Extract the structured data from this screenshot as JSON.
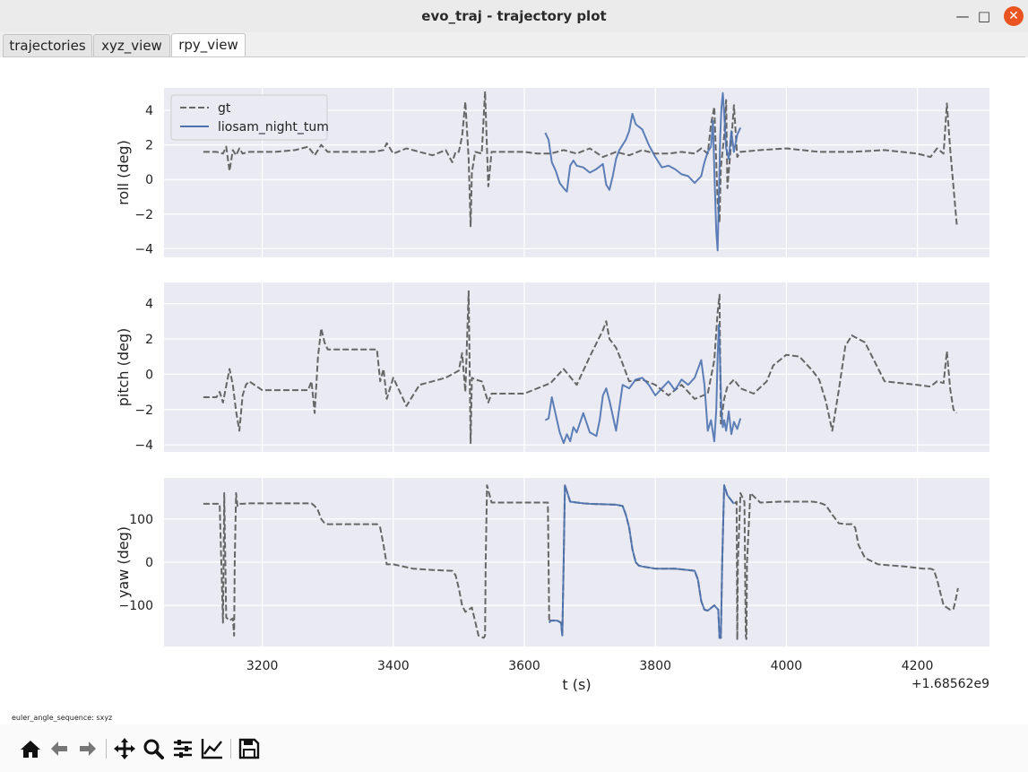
{
  "window": {
    "title": "evo_traj - trajectory plot"
  },
  "tabs": [
    {
      "label": "trajectories",
      "active": false
    },
    {
      "label": "xyz_view",
      "active": false
    },
    {
      "label": "rpy_view",
      "active": true
    }
  ],
  "status_text": "euler_angle_sequence: sxyz",
  "toolbar": {
    "icons": [
      "home-icon",
      "back-arrow-icon",
      "forward-arrow-icon",
      "pan-icon",
      "zoom-icon",
      "subplots-config-icon",
      "axes-edit-icon",
      "save-icon"
    ]
  },
  "colors": {
    "gt": "#666666",
    "estimate": "#4c72b0",
    "axes_bg": "#eaeaf2",
    "grid": "#ffffff",
    "close_btn": "#e95420"
  },
  "chart_data": {
    "type": "line",
    "xlabel": "t (s)",
    "x_offset_label": "+1.68562e9",
    "xlim": [
      3050,
      4310
    ],
    "xticks": [
      3200,
      3400,
      3600,
      3800,
      4000,
      4200
    ],
    "legend": {
      "placement": "top-left",
      "entries": [
        "gt",
        "liosam_night_tum"
      ]
    },
    "grid": true,
    "subplots": [
      {
        "ylabel": "roll (deg)",
        "ylim": [
          -4.5,
          5.3
        ],
        "yticks": [
          4,
          2,
          0,
          -2,
          -4
        ],
        "series": [
          {
            "name": "gt",
            "style": "dashed",
            "x": [
              3110,
              3130,
              3140,
              3145,
              3150,
              3155,
              3160,
              3165,
              3170,
              3180,
              3190,
              3200,
              3220,
              3250,
              3270,
              3280,
              3290,
              3300,
              3330,
              3370,
              3385,
              3390,
              3400,
              3420,
              3440,
              3460,
              3480,
              3490,
              3495,
              3500,
              3505,
              3510,
              3515,
              3518,
              3520,
              3525,
              3535,
              3540,
              3545,
              3550,
              3560,
              3600,
              3620,
              3640,
              3660,
              3680,
              3700,
              3720,
              3740,
              3760,
              3780,
              3800,
              3820,
              3840,
              3860,
              3870,
              3880,
              3885,
              3890,
              3895,
              3898,
              3900,
              3905,
              3908,
              3910,
              3915,
              3920,
              3925,
              3930,
              3960,
              4000,
              4050,
              4100,
              4150,
              4200,
              4220,
              4230,
              4240,
              4245,
              4250,
              4255,
              4260
            ],
            "y": [
              1.6,
              1.6,
              1.5,
              1.9,
              0.5,
              1.7,
              1.4,
              1.8,
              1.5,
              1.6,
              1.6,
              1.6,
              1.6,
              1.7,
              1.9,
              1.4,
              2.0,
              1.6,
              1.6,
              1.6,
              1.7,
              2.1,
              1.5,
              1.8,
              1.6,
              1.4,
              1.7,
              1.0,
              1.6,
              1.6,
              2.5,
              4.5,
              1.2,
              -2.7,
              0.4,
              1.6,
              1.5,
              5.1,
              -0.4,
              1.6,
              1.6,
              1.6,
              1.5,
              1.5,
              1.7,
              1.5,
              1.8,
              1.3,
              1.6,
              1.4,
              1.7,
              1.5,
              1.5,
              1.6,
              1.5,
              1.8,
              1.5,
              3.2,
              4.2,
              -1.3,
              -2.5,
              0.7,
              2.5,
              4.6,
              -0.5,
              1.8,
              4.3,
              1.3,
              1.6,
              1.7,
              1.8,
              1.6,
              1.6,
              1.7,
              1.5,
              1.3,
              1.8,
              1.5,
              4.4,
              1.8,
              -0.4,
              -2.6
            ]
          },
          {
            "name": "liosam_night_tum",
            "style": "solid",
            "x": [
              3632,
              3637,
              3642,
              3648,
              3654,
              3660,
              3665,
              3670,
              3675,
              3680,
              3690,
              3700,
              3710,
              3720,
              3725,
              3730,
              3735,
              3740,
              3745,
              3750,
              3755,
              3760,
              3765,
              3770,
              3780,
              3790,
              3800,
              3810,
              3820,
              3830,
              3840,
              3850,
              3860,
              3870,
              3875,
              3880,
              3885,
              3888,
              3890,
              3893,
              3895,
              3897,
              3899,
              3901,
              3903,
              3905,
              3908,
              3912,
              3916,
              3920,
              3925,
              3930
            ],
            "y": [
              2.7,
              2.3,
              1.0,
              0.5,
              -0.2,
              -0.5,
              -0.7,
              0.8,
              1.1,
              0.8,
              0.7,
              0.4,
              0.6,
              0.9,
              -0.3,
              -0.6,
              0.2,
              1.2,
              1.7,
              2.0,
              2.3,
              2.8,
              3.8,
              3.2,
              2.9,
              2.0,
              1.3,
              0.7,
              0.8,
              0.6,
              0.3,
              0.2,
              -0.2,
              0.2,
              1.0,
              1.6,
              1.9,
              3.4,
              0.5,
              -3.0,
              -4.1,
              -1.0,
              2.5,
              4.2,
              5.0,
              3.8,
              1.8,
              1.2,
              2.8,
              1.6,
              2.6,
              3.0
            ]
          }
        ]
      },
      {
        "ylabel": "pitch (deg)",
        "ylim": [
          -4.4,
          5.2
        ],
        "yticks": [
          4,
          2,
          0,
          -2,
          -4
        ],
        "series": [
          {
            "name": "gt",
            "style": "dashed",
            "x": [
              3110,
              3130,
              3135,
              3140,
              3150,
              3155,
              3160,
              3165,
              3170,
              3175,
              3180,
              3200,
              3230,
              3270,
              3275,
              3280,
              3285,
              3290,
              3295,
              3300,
              3330,
              3375,
              3380,
              3385,
              3390,
              3400,
              3420,
              3440,
              3460,
              3480,
              3500,
              3505,
              3510,
              3515,
              3518,
              3520,
              3525,
              3535,
              3545,
              3550,
              3600,
              3620,
              3640,
              3660,
              3680,
              3700,
              3720,
              3725,
              3730,
              3740,
              3750,
              3760,
              3780,
              3800,
              3820,
              3840,
              3860,
              3880,
              3890,
              3895,
              3898,
              3900,
              3905,
              3910,
              3920,
              3930,
              3950,
              3970,
              3980,
              4000,
              4020,
              4040,
              4050,
              4060,
              4070,
              4080,
              4090,
              4100,
              4120,
              4150,
              4200,
              4220,
              4230,
              4240,
              4245,
              4250,
              4255,
              4260
            ],
            "y": [
              -1.3,
              -1.3,
              -1.0,
              -1.6,
              0.3,
              -0.6,
              -2.1,
              -3.2,
              -1.2,
              -0.6,
              -0.4,
              -0.9,
              -0.9,
              -0.9,
              -0.4,
              -2.2,
              1.0,
              2.6,
              1.8,
              1.4,
              1.4,
              1.4,
              -0.4,
              0.3,
              -1.4,
              -0.2,
              -1.8,
              -0.6,
              -0.4,
              -0.2,
              0.2,
              1.2,
              -1.0,
              4.7,
              -3.9,
              -0.2,
              -0.3,
              -0.4,
              -1.6,
              -1.1,
              -1.1,
              -0.8,
              -0.5,
              0.3,
              -0.6,
              1.0,
              2.5,
              3.0,
              2.0,
              1.5,
              0.6,
              -0.4,
              -0.3,
              -0.6,
              -1.2,
              -0.6,
              -1.4,
              -1.1,
              0.8,
              3.5,
              4.5,
              -2.8,
              -1.4,
              -0.7,
              -0.3,
              -0.8,
              -1.1,
              -0.4,
              0.5,
              1.1,
              1.0,
              0.2,
              -0.3,
              -1.5,
              -3.2,
              -0.9,
              1.6,
              2.2,
              1.8,
              -0.4,
              -0.6,
              -0.7,
              -0.4,
              -0.5,
              1.3,
              -0.8,
              -2.0,
              -2.2
            ]
          },
          {
            "name": "liosam_night_tum",
            "style": "solid",
            "x": [
              3632,
              3637,
              3642,
              3648,
              3654,
              3660,
              3665,
              3670,
              3675,
              3680,
              3690,
              3700,
              3710,
              3715,
              3720,
              3725,
              3730,
              3740,
              3750,
              3760,
              3770,
              3780,
              3790,
              3800,
              3810,
              3820,
              3830,
              3840,
              3850,
              3860,
              3870,
              3875,
              3880,
              3885,
              3890,
              3893,
              3895,
              3897,
              3899,
              3901,
              3903,
              3905,
              3908,
              3912,
              3916,
              3920,
              3925,
              3930
            ],
            "y": [
              -2.6,
              -2.5,
              -1.3,
              -2.3,
              -3.3,
              -3.9,
              -3.4,
              -3.8,
              -3.0,
              -3.3,
              -2.2,
              -3.3,
              -3.5,
              -2.6,
              -1.2,
              -0.8,
              -1.5,
              -3.2,
              -0.6,
              -0.8,
              -0.3,
              -0.2,
              -0.6,
              -1.2,
              -0.8,
              -0.4,
              -0.9,
              -0.3,
              -0.6,
              -0.2,
              0.8,
              -0.6,
              -3.2,
              -2.6,
              -3.8,
              -2.0,
              1.0,
              2.8,
              0.4,
              -2.2,
              -3.0,
              -2.6,
              -3.2,
              -2.1,
              -3.4,
              -2.7,
              -3.1,
              -2.5
            ]
          }
        ]
      },
      {
        "ylabel": "yaw (deg)",
        "ylim": [
          -195,
          195
        ],
        "yticks": [
          100,
          0,
          -100
        ],
        "series": [
          {
            "name": "gt",
            "style": "dashed",
            "x": [
              3110,
              3135,
              3140,
              3141,
              3142,
              3145,
              3150,
              3155,
              3157,
              3158,
              3160,
              3162,
              3165,
              3170,
              3180,
              3200,
              3230,
              3270,
              3275,
              3280,
              3285,
              3290,
              3295,
              3300,
              3340,
              3375,
              3380,
              3385,
              3390,
              3400,
              3430,
              3460,
              3490,
              3495,
              3500,
              3505,
              3510,
              3515,
              3520,
              3530,
              3538,
              3540,
              3541,
              3543,
              3546,
              3550,
              3560,
              3600,
              3620,
              3636,
              3638,
              3640,
              3650,
              3656,
              3658,
              3660,
              3662,
              3670,
              3690,
              3700,
              3720,
              3740,
              3750,
              3755,
              3760,
              3765,
              3770,
              3775,
              3780,
              3800,
              3830,
              3860,
              3865,
              3870,
              3875,
              3880,
              3890,
              3896,
              3898,
              3900,
              3902,
              3905,
              3910,
              3920,
              3924,
              3925,
              3926,
              3930,
              3936,
              3938,
              3939,
              3940,
              3945,
              3960,
              3990,
              4020,
              4040,
              4050,
              4060,
              4070,
              4080,
              4090,
              4100,
              4105,
              4110,
              4120,
              4140,
              4180,
              4210,
              4220,
              4225,
              4230,
              4240,
              4250,
              4255,
              4258,
              4262
            ],
            "y": [
              135,
              135,
              -140,
              0,
              160,
              -128,
              -135,
              -130,
              -170,
              0,
              160,
              130,
              135,
              135,
              136,
              136,
              136,
              136,
              136,
              130,
              120,
              100,
              90,
              88,
              88,
              88,
              80,
              40,
              -5,
              -5,
              -15,
              -18,
              -20,
              -30,
              -60,
              -100,
              -115,
              -110,
              -105,
              -170,
              -175,
              -170,
              0,
              178,
              160,
              138,
              138,
              138,
              138,
              138,
              -140,
              -135,
              -135,
              -140,
              -170,
              0,
              178,
              140,
              136,
              135,
              134,
              133,
              130,
              110,
              80,
              30,
              0,
              -8,
              -10,
              -15,
              -15,
              -20,
              -40,
              -90,
              -110,
              -112,
              -100,
              -110,
              -175,
              -175,
              0,
              178,
              155,
              135,
              140,
              -180,
              0,
              160,
              140,
              -170,
              -178,
              0,
              160,
              138,
              140,
              140,
              140,
              138,
              132,
              110,
              90,
              88,
              88,
              80,
              40,
              10,
              -5,
              -10,
              -15,
              -15,
              -18,
              -40,
              -100,
              -110,
              -108,
              -90,
              -60,
              -15,
              -12
            ]
          },
          {
            "name": "liosam_night_tum",
            "style": "solid",
            "x": [
              3638,
              3640,
              3650,
              3656,
              3658,
              3660,
              3662,
              3670,
              3690,
              3700,
              3720,
              3740,
              3750,
              3755,
              3760,
              3765,
              3770,
              3775,
              3780,
              3800,
              3830,
              3860,
              3865,
              3870,
              3875,
              3880,
              3890,
              3896,
              3898,
              3900,
              3902,
              3905,
              3910,
              3920
            ],
            "y": [
              -140,
              -135,
              -135,
              -140,
              -170,
              0,
              178,
              140,
              136,
              135,
              134,
              133,
              130,
              110,
              80,
              30,
              0,
              -8,
              -10,
              -15,
              -15,
              -20,
              -40,
              -90,
              -110,
              -112,
              -100,
              -110,
              -175,
              -175,
              0,
              178,
              155,
              135
            ]
          }
        ]
      }
    ]
  }
}
